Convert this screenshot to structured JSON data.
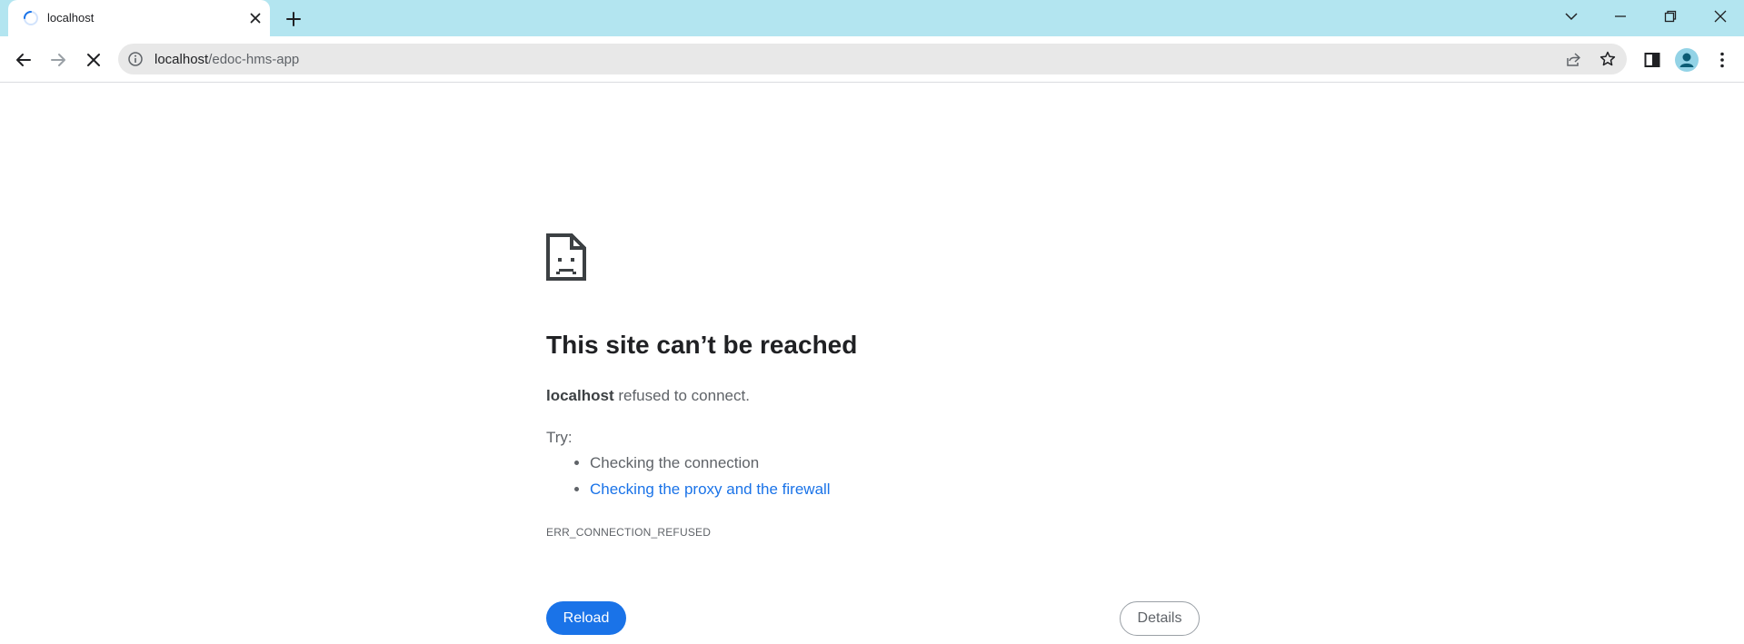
{
  "window": {
    "tab": {
      "title": "localhost",
      "loading_icon": "spinner-icon",
      "close_icon": "close-icon"
    },
    "new_tab_icon": "plus-icon",
    "controls": {
      "tab_search_icon": "chevron-down-icon",
      "minimize_icon": "minimize-icon",
      "restore_icon": "restore-icon",
      "close_icon": "close-icon"
    }
  },
  "toolbar": {
    "back_icon": "back-arrow-icon",
    "forward_icon": "forward-arrow-icon",
    "stop_icon": "stop-loading-icon",
    "address": {
      "info_icon": "info-icon",
      "host": "localhost",
      "path": "/edoc-hms-app",
      "share_icon": "share-icon",
      "bookmark_icon": "star-icon"
    },
    "side_panel_icon": "side-panel-icon",
    "profile_icon": "profile-avatar-icon",
    "menu_icon": "kebab-menu-icon"
  },
  "error_page": {
    "icon": "sad-page-icon",
    "heading": "This site can’t be reached",
    "host": "localhost",
    "message": " refused to connect.",
    "try_label": "Try:",
    "suggestions": [
      "Checking the connection",
      "Checking the proxy and the firewall"
    ],
    "error_code": "ERR_CONNECTION_REFUSED",
    "reload_label": "Reload",
    "details_label": "Details"
  },
  "colors": {
    "tabstrip_bg": "#b3e5f0",
    "link": "#1a73e8",
    "primary_button": "#1a73e8",
    "text_secondary": "#5f6368"
  }
}
